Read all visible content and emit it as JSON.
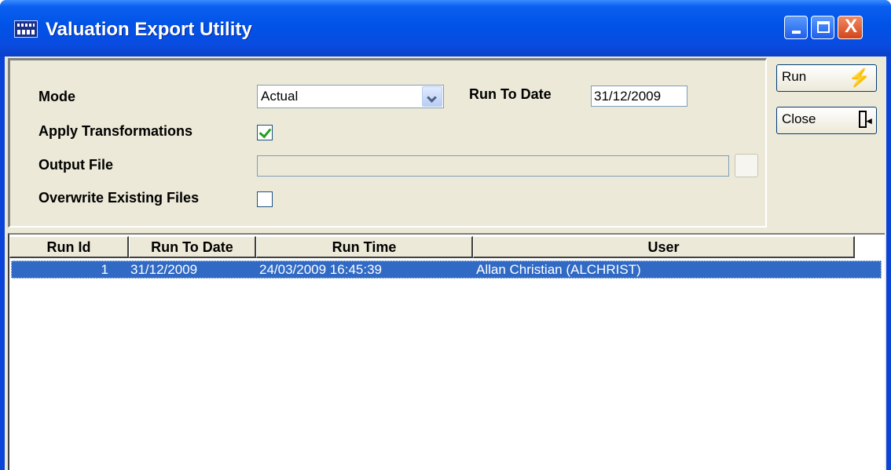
{
  "window": {
    "title": "Valuation Export Utility",
    "close_glyph": "X"
  },
  "form": {
    "mode_label": "Mode",
    "mode_value": "Actual",
    "run_to_date_label": "Run To Date",
    "run_to_date_value": "31/12/2009",
    "apply_transformations_label": "Apply Transformations",
    "apply_transformations_checked": true,
    "output_file_label": "Output File",
    "output_file_value": "",
    "overwrite_label": "Overwrite Existing Files",
    "overwrite_checked": false
  },
  "buttons": {
    "run_label": "Run",
    "close_label": "Close",
    "run_icon": "lightning-icon",
    "close_icon": "exit-door-icon"
  },
  "grid": {
    "columns": [
      "Run Id",
      "Run To Date",
      "Run Time",
      "User"
    ],
    "rows": [
      {
        "run_id": "1",
        "run_to_date": "31/12/2009",
        "run_time": "24/03/2009 16:45:39",
        "user": "Allan Christian (ALCHRIST)"
      }
    ]
  },
  "colors": {
    "titlebar": "#0053e6",
    "selection": "#316ac5",
    "face": "#ece9d8"
  }
}
